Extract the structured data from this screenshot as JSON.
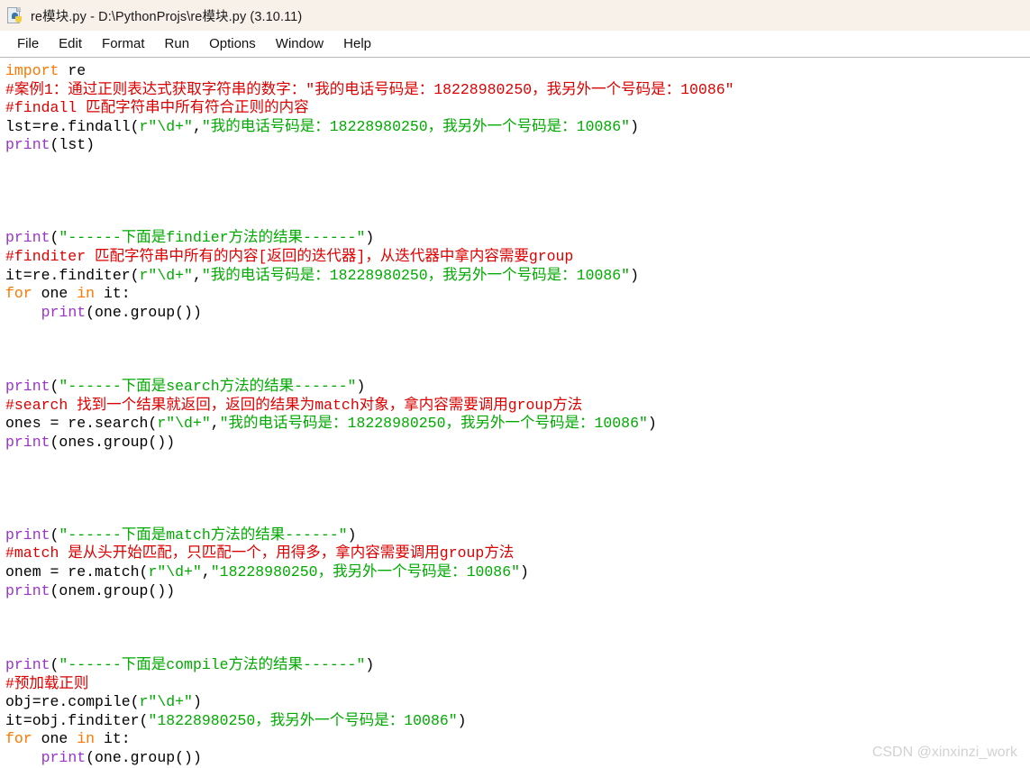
{
  "window": {
    "title": "re模块.py - D:\\PythonProjs\\re模块.py (3.10.11)",
    "icon": "python-file-icon"
  },
  "menubar": {
    "items": [
      {
        "label": "File"
      },
      {
        "label": "Edit"
      },
      {
        "label": "Format"
      },
      {
        "label": "Run"
      },
      {
        "label": "Options"
      },
      {
        "label": "Window"
      },
      {
        "label": "Help"
      }
    ]
  },
  "colors": {
    "titlebar_bg": "#f8f1e9",
    "menubar_bg": "#ffffff",
    "editor_bg": "#ffffff",
    "keyword": "#ff7700",
    "builtin": "#9933cc",
    "string": "#00aa00",
    "comment": "#dd0000",
    "text": "#000000",
    "watermark": "#d2d2d2"
  },
  "editor": {
    "lines": [
      {
        "n": 1,
        "tokens": [
          {
            "t": "kw",
            "v": "import"
          },
          {
            "t": "plain",
            "v": " re"
          }
        ]
      },
      {
        "n": 2,
        "tokens": [
          {
            "t": "cmt",
            "v": "#案例1：通过正则表达式获取字符串的数字：\"我的电话号码是：18228980250，我另外一个号码是：10086\""
          }
        ]
      },
      {
        "n": 3,
        "tokens": [
          {
            "t": "cmt",
            "v": "#findall 匹配字符串中所有符合正则的内容"
          }
        ]
      },
      {
        "n": 4,
        "tokens": [
          {
            "t": "plain",
            "v": "lst=re.findall("
          },
          {
            "t": "str",
            "v": "r\"\\d+\""
          },
          {
            "t": "plain",
            "v": ","
          },
          {
            "t": "str",
            "v": "\"我的电话号码是：18228980250，我另外一个号码是：10086\""
          },
          {
            "t": "plain",
            "v": ")"
          }
        ]
      },
      {
        "n": 5,
        "tokens": [
          {
            "t": "bi",
            "v": "print"
          },
          {
            "t": "plain",
            "v": "(lst)"
          }
        ]
      },
      {
        "n": 6,
        "tokens": []
      },
      {
        "n": 7,
        "tokens": []
      },
      {
        "n": 8,
        "tokens": []
      },
      {
        "n": 9,
        "tokens": []
      },
      {
        "n": 10,
        "tokens": [
          {
            "t": "bi",
            "v": "print"
          },
          {
            "t": "plain",
            "v": "("
          },
          {
            "t": "str",
            "v": "\"------下面是findier方法的结果------\""
          },
          {
            "t": "plain",
            "v": ")"
          }
        ]
      },
      {
        "n": 11,
        "tokens": [
          {
            "t": "cmt",
            "v": "#finditer 匹配字符串中所有的内容[返回的迭代器]，从迭代器中拿内容需要group"
          }
        ]
      },
      {
        "n": 12,
        "tokens": [
          {
            "t": "plain",
            "v": "it=re.finditer("
          },
          {
            "t": "str",
            "v": "r\"\\d+\""
          },
          {
            "t": "plain",
            "v": ","
          },
          {
            "t": "str",
            "v": "\"我的电话号码是：18228980250，我另外一个号码是：10086\""
          },
          {
            "t": "plain",
            "v": ")"
          }
        ]
      },
      {
        "n": 13,
        "tokens": [
          {
            "t": "kw",
            "v": "for"
          },
          {
            "t": "plain",
            "v": " one "
          },
          {
            "t": "kw",
            "v": "in"
          },
          {
            "t": "plain",
            "v": " it:"
          }
        ]
      },
      {
        "n": 14,
        "tokens": [
          {
            "t": "plain",
            "v": "    "
          },
          {
            "t": "bi",
            "v": "print"
          },
          {
            "t": "plain",
            "v": "(one.group())"
          }
        ]
      },
      {
        "n": 15,
        "tokens": []
      },
      {
        "n": 16,
        "tokens": []
      },
      {
        "n": 17,
        "tokens": []
      },
      {
        "n": 18,
        "tokens": [
          {
            "t": "bi",
            "v": "print"
          },
          {
            "t": "plain",
            "v": "("
          },
          {
            "t": "str",
            "v": "\"------下面是search方法的结果------\""
          },
          {
            "t": "plain",
            "v": ")"
          }
        ]
      },
      {
        "n": 19,
        "tokens": [
          {
            "t": "cmt",
            "v": "#search 找到一个结果就返回，返回的结果为match对象，拿内容需要调用group方法"
          }
        ]
      },
      {
        "n": 20,
        "tokens": [
          {
            "t": "plain",
            "v": "ones = re.search("
          },
          {
            "t": "str",
            "v": "r\"\\d+\""
          },
          {
            "t": "plain",
            "v": ","
          },
          {
            "t": "str",
            "v": "\"我的电话号码是：18228980250，我另外一个号码是：10086\""
          },
          {
            "t": "plain",
            "v": ")"
          }
        ]
      },
      {
        "n": 21,
        "tokens": [
          {
            "t": "bi",
            "v": "print"
          },
          {
            "t": "plain",
            "v": "(ones.group())"
          }
        ]
      },
      {
        "n": 22,
        "tokens": []
      },
      {
        "n": 23,
        "tokens": []
      },
      {
        "n": 24,
        "tokens": []
      },
      {
        "n": 25,
        "tokens": []
      },
      {
        "n": 26,
        "tokens": [
          {
            "t": "bi",
            "v": "print"
          },
          {
            "t": "plain",
            "v": "("
          },
          {
            "t": "str",
            "v": "\"------下面是match方法的结果------\""
          },
          {
            "t": "plain",
            "v": ")"
          }
        ]
      },
      {
        "n": 27,
        "tokens": [
          {
            "t": "cmt",
            "v": "#match 是从头开始匹配，只匹配一个，用得多，拿内容需要调用group方法"
          }
        ]
      },
      {
        "n": 28,
        "tokens": [
          {
            "t": "plain",
            "v": "onem = re.match("
          },
          {
            "t": "str",
            "v": "r\"\\d+\""
          },
          {
            "t": "plain",
            "v": ","
          },
          {
            "t": "str",
            "v": "\"18228980250，我另外一个号码是：10086\""
          },
          {
            "t": "plain",
            "v": ")"
          }
        ]
      },
      {
        "n": 29,
        "tokens": [
          {
            "t": "bi",
            "v": "print"
          },
          {
            "t": "plain",
            "v": "(onem.group())"
          }
        ]
      },
      {
        "n": 30,
        "tokens": []
      },
      {
        "n": 31,
        "tokens": []
      },
      {
        "n": 32,
        "tokens": []
      },
      {
        "n": 33,
        "tokens": [
          {
            "t": "bi",
            "v": "print"
          },
          {
            "t": "plain",
            "v": "("
          },
          {
            "t": "str",
            "v": "\"------下面是compile方法的结果------\""
          },
          {
            "t": "plain",
            "v": ")"
          }
        ]
      },
      {
        "n": 34,
        "tokens": [
          {
            "t": "cmt",
            "v": "#预加载正则"
          }
        ]
      },
      {
        "n": 35,
        "tokens": [
          {
            "t": "plain",
            "v": "obj=re.compile("
          },
          {
            "t": "str",
            "v": "r\"\\d+\""
          },
          {
            "t": "plain",
            "v": ")"
          }
        ]
      },
      {
        "n": 36,
        "tokens": [
          {
            "t": "plain",
            "v": "it=obj.finditer("
          },
          {
            "t": "str",
            "v": "\"18228980250，我另外一个号码是：10086\""
          },
          {
            "t": "plain",
            "v": ")"
          }
        ]
      },
      {
        "n": 37,
        "tokens": [
          {
            "t": "kw",
            "v": "for"
          },
          {
            "t": "plain",
            "v": " one "
          },
          {
            "t": "kw",
            "v": "in"
          },
          {
            "t": "plain",
            "v": " it:"
          }
        ]
      },
      {
        "n": 38,
        "tokens": [
          {
            "t": "plain",
            "v": "    "
          },
          {
            "t": "bi",
            "v": "print"
          },
          {
            "t": "plain",
            "v": "(one.group())"
          }
        ]
      }
    ]
  },
  "watermark": {
    "text": "CSDN @xinxinzi_work"
  }
}
